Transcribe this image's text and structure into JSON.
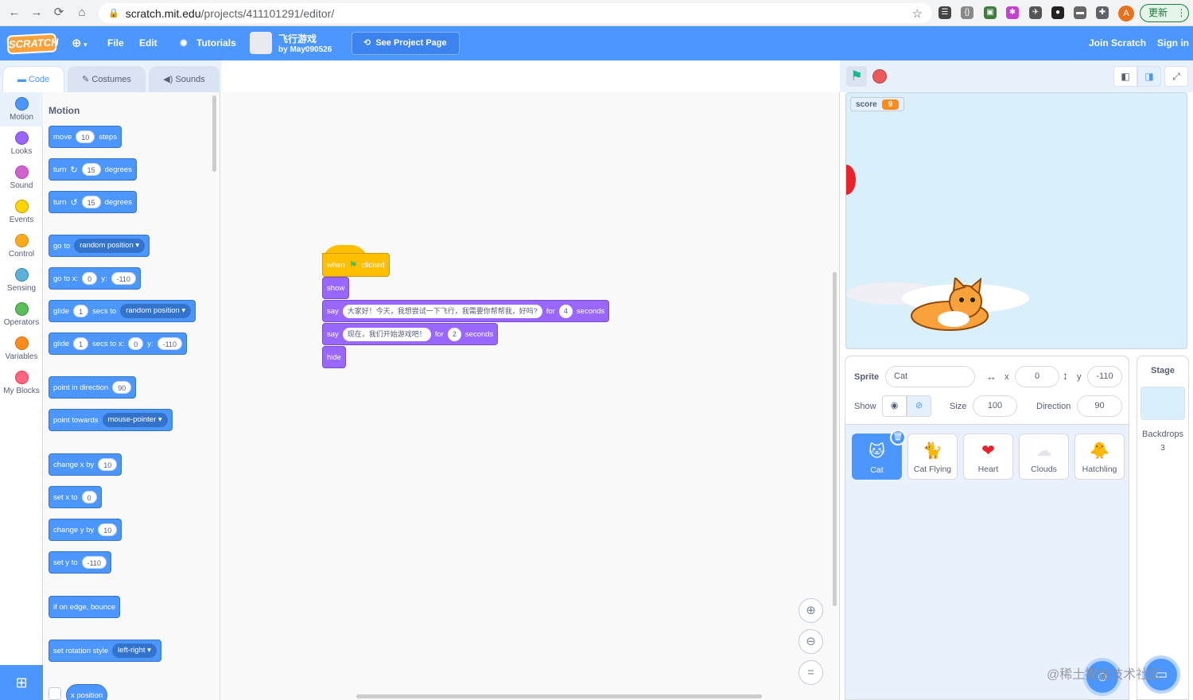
{
  "browser": {
    "url_host": "scratch.mit.edu",
    "url_path": "/projects/411101291/editor/",
    "update_label": "更新",
    "avatar_letter": "A",
    "nav": {
      "back": "←",
      "forward": "→",
      "reload": "⟳",
      "home": "⌂",
      "star": "☆",
      "menu": "⋮"
    }
  },
  "menubar": {
    "logo": "SCRATCH",
    "file": "File",
    "edit": "Edit",
    "tutorials": "Tutorials",
    "project_title": "飞行游戏",
    "project_by": "by May090526",
    "see_project": "See Project Page",
    "join": "Join Scratch",
    "signin": "Sign in",
    "color": "#4c97ff"
  },
  "tabs": {
    "code": "Code",
    "costumes": "Costumes",
    "sounds": "Sounds"
  },
  "categories": [
    {
      "label": "Motion",
      "color": "#4c97ff"
    },
    {
      "label": "Looks",
      "color": "#9966ff"
    },
    {
      "label": "Sound",
      "color": "#cf63cf"
    },
    {
      "label": "Events",
      "color": "#ffd500"
    },
    {
      "label": "Control",
      "color": "#ffab19"
    },
    {
      "label": "Sensing",
      "color": "#5cb1d6"
    },
    {
      "label": "Operators",
      "color": "#59c059"
    },
    {
      "label": "Variables",
      "color": "#ff8c1a"
    },
    {
      "label": "My Blocks",
      "color": "#ff6680"
    }
  ],
  "palette": {
    "section": "Motion",
    "move": {
      "a": "move",
      "v": "10",
      "b": "steps"
    },
    "turn_cw": {
      "a": "turn",
      "v": "15",
      "b": "degrees"
    },
    "turn_ccw": {
      "a": "turn",
      "v": "15",
      "b": "degrees"
    },
    "goto": {
      "a": "go to",
      "d": "random position ▾"
    },
    "goto_xy": {
      "a": "go to x:",
      "x": "0",
      "b": "y:",
      "y": "-110"
    },
    "glide_to": {
      "a": "glide",
      "v": "1",
      "b": "secs to",
      "d": "random position ▾"
    },
    "glide_xy": {
      "a": "glide",
      "v": "1",
      "b": "secs to x:",
      "x": "0",
      "c": "y:",
      "y": "-110"
    },
    "point_dir": {
      "a": "point in direction",
      "v": "90"
    },
    "point_towards": {
      "a": "point towards",
      "d": "mouse-pointer ▾"
    },
    "change_x": {
      "a": "change x by",
      "v": "10"
    },
    "set_x": {
      "a": "set x to",
      "v": "0"
    },
    "change_y": {
      "a": "change y by",
      "v": "10"
    },
    "set_y": {
      "a": "set y to",
      "v": "-110"
    },
    "bounce": {
      "a": "if on edge, bounce"
    },
    "rotation": {
      "a": "set rotation style",
      "d": "left-right ▾"
    },
    "x_position": {
      "a": "x position"
    }
  },
  "script": {
    "hat": {
      "a": "when",
      "b": "clicked"
    },
    "show": "show",
    "say1": {
      "a": "say",
      "msg": "大家好！今天，我想尝试一下飞行，我需要你帮帮我，好吗?",
      "b": "for",
      "v": "4",
      "c": "seconds"
    },
    "say2": {
      "a": "say",
      "msg": "现在，我们开始游戏吧！",
      "b": "for",
      "v": "2",
      "c": "seconds"
    },
    "hide": "hide"
  },
  "zoom": {
    "in": "⊕",
    "out": "⊖",
    "reset": "="
  },
  "stage": {
    "score_label": "score",
    "score_value": "9"
  },
  "sprite_info": {
    "sprite_label": "Sprite",
    "sprite_name": "Cat",
    "x_label": "x",
    "x_value": "0",
    "y_label": "y",
    "y_value": "-110",
    "show_label": "Show",
    "size_label": "Size",
    "size_value": "100",
    "direction_label": "Direction",
    "direction_value": "90"
  },
  "sprites": [
    {
      "name": "Cat",
      "thumb": "🐱"
    },
    {
      "name": "Cat Flying",
      "thumb": "🐈"
    },
    {
      "name": "Heart",
      "thumb": "❤"
    },
    {
      "name": "Clouds",
      "thumb": "☁"
    },
    {
      "name": "Hatchling",
      "thumb": "🐥"
    }
  ],
  "stage_pane": {
    "title": "Stage",
    "backdrops_label": "Backdrops",
    "backdrops_count": "3"
  },
  "watermark": "@稀土掘金技术社区"
}
